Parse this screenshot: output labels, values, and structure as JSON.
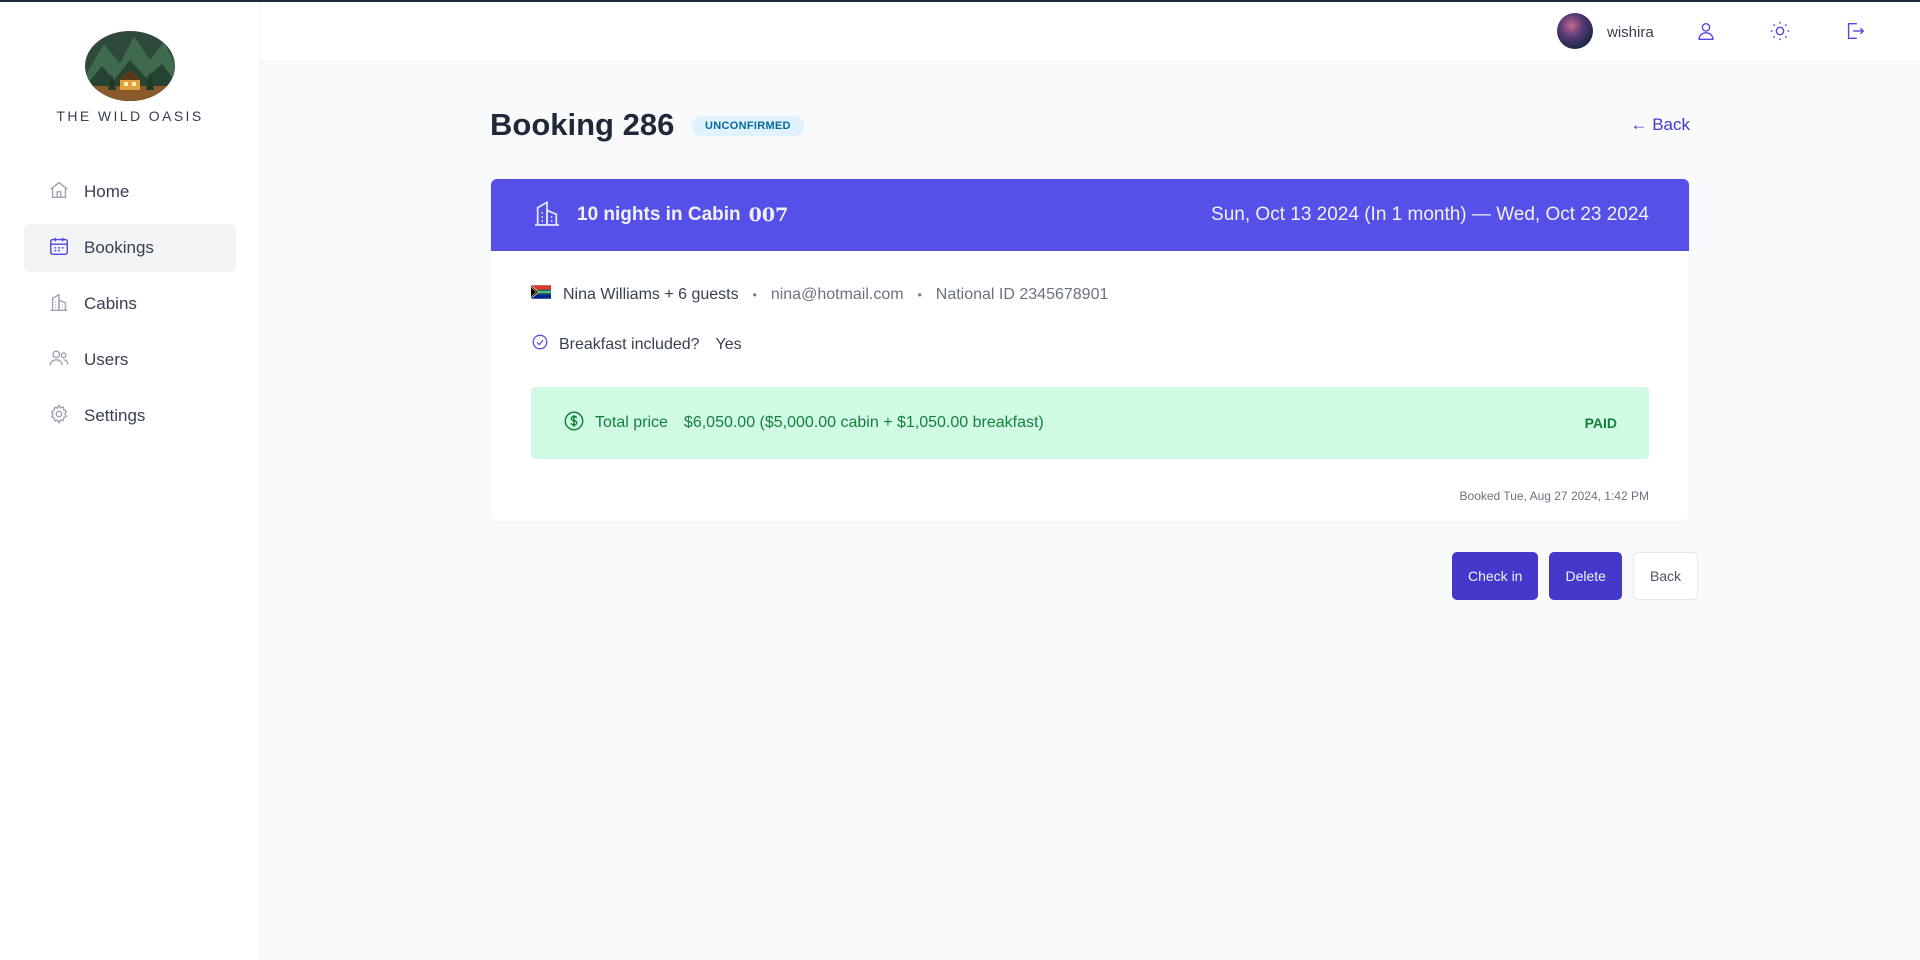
{
  "sidebar": {
    "logo_text": "THE WILD OASIS",
    "items": [
      {
        "label": "Home",
        "icon": "home-icon"
      },
      {
        "label": "Bookings",
        "icon": "calendar-icon",
        "active": true
      },
      {
        "label": "Cabins",
        "icon": "building-icon"
      },
      {
        "label": "Users",
        "icon": "users-icon"
      },
      {
        "label": "Settings",
        "icon": "gear-icon"
      }
    ]
  },
  "header": {
    "username": "wishira",
    "icons": [
      "user-icon",
      "sun-icon",
      "logout-icon"
    ]
  },
  "booking": {
    "title": "Booking 286",
    "status": "UNCONFIRMED",
    "back_link": "← Back",
    "nights": "10 nights in Cabin",
    "cabin": "007",
    "dates": "Sun, Oct 13 2024 (In 1 month) — Wed, Oct 23 2024",
    "guest": "Nina Williams + 6 guests",
    "separator": "•",
    "email": "nina@hotmail.com",
    "national_id": "National ID 2345678901",
    "breakfast_label": "Breakfast included?",
    "breakfast_value": "Yes",
    "price_label": "Total price",
    "price_value": "$6,050.00 ($5,000.00 cabin + $1,050.00 breakfast)",
    "paid_status": "PAID",
    "booked_at": "Booked Tue, Aug 27 2024, 1:42 PM"
  },
  "actions": {
    "check_in": "Check in",
    "delete": "Delete",
    "back": "Back"
  },
  "colors": {
    "accent": "#4338ca",
    "card_header": "#5750e8",
    "paid_bg": "#d1fae5",
    "paid_text": "#15803d",
    "status_bg": "#e0f2fe",
    "status_text": "#0369a1"
  }
}
